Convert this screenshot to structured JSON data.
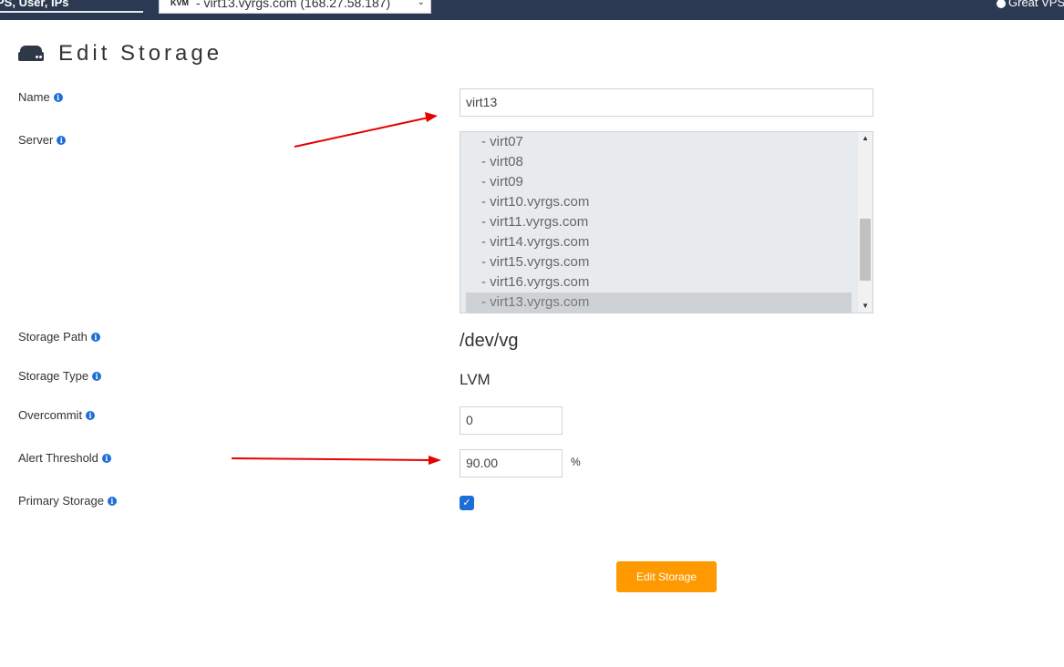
{
  "topbar": {
    "search_text": "PS, User, IPs",
    "server_select_badge": "KVM",
    "server_select_value": "- virt13.vyrgs.com (168.27.58.187)",
    "user_text": "Great VPS"
  },
  "page": {
    "title": "Edit Storage",
    "title_icon": "hdd-icon"
  },
  "form": {
    "name_label": "Name",
    "name_value": "virt13",
    "server_label": "Server",
    "server_options": [
      "- virt07",
      "- virt08",
      "- virt09",
      "- virt10.vyrgs.com",
      "- virt11.vyrgs.com",
      "- virt14.vyrgs.com",
      "- virt15.vyrgs.com",
      "- virt16.vyrgs.com",
      "- virt13.vyrgs.com"
    ],
    "server_selected": "- virt13.vyrgs.com",
    "storage_path_label": "Storage Path",
    "storage_path_value": "/dev/vg",
    "storage_type_label": "Storage Type",
    "storage_type_value": "LVM",
    "overcommit_label": "Overcommit",
    "overcommit_value": "0",
    "alert_threshold_label": "Alert Threshold",
    "alert_threshold_value": "90.00",
    "alert_threshold_unit": "%",
    "primary_storage_label": "Primary Storage",
    "primary_storage_checked": true,
    "submit_label": "Edit Storage"
  },
  "colors": {
    "topbar": "#2b3a52",
    "accent_button": "#ff9900",
    "info_icon": "#1c6fd6",
    "annotation_arrow": "#e60000"
  }
}
